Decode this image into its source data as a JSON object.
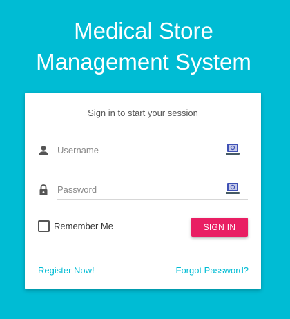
{
  "header": {
    "title_line1": "Medical Store",
    "title_line2": "Management System"
  },
  "login": {
    "subtitle": "Sign in to start your session",
    "username_placeholder": "Username",
    "password_placeholder": "Password",
    "remember_label": "Remember Me",
    "remember_checked": false,
    "signin_label": "SIGN IN",
    "register_link": "Register Now!",
    "forgot_link": "Forgot Password?"
  },
  "colors": {
    "background": "#00bcd4",
    "accent": "#e91e63",
    "link": "#00bcd4"
  },
  "icons": {
    "username_field": "person-icon",
    "password_field": "lock-icon",
    "autofill": "password-manager-icon"
  }
}
